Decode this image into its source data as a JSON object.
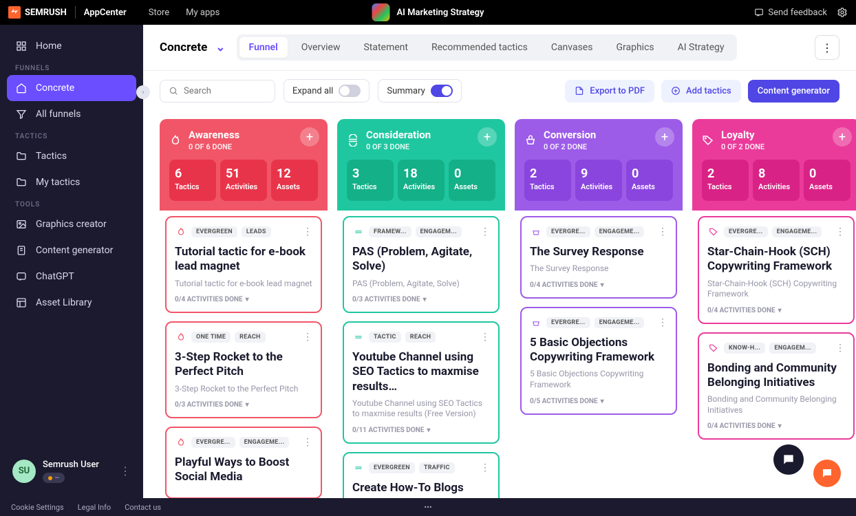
{
  "topbar": {
    "brand": "SEMRUSH",
    "appcenter": "AppCenter",
    "store": "Store",
    "myapps": "My apps",
    "title": "AI Marketing Strategy",
    "feedback": "Send feedback"
  },
  "sidebar": {
    "home": "Home",
    "funnels_label": "FUNNELS",
    "concrete": "Concrete",
    "all_funnels": "All funnels",
    "tactics_label": "TACTICS",
    "tactics": "Tactics",
    "my_tactics": "My tactics",
    "tools_label": "TOOLS",
    "graphics_creator": "Graphics creator",
    "content_generator": "Content generator",
    "chatgpt": "ChatGPT",
    "asset_library": "Asset Library",
    "user": {
      "initials": "SU",
      "name": "Semrush User",
      "plan": "--"
    }
  },
  "subheader": {
    "workspace": "Concrete",
    "tabs": {
      "funnel": "Funnel",
      "overview": "Overview",
      "statement": "Statement",
      "recommended": "Recommended tactics",
      "canvases": "Canvases",
      "graphics": "Graphics",
      "ai_strategy": "AI Strategy"
    }
  },
  "toolbar": {
    "search_placeholder": "Search",
    "expand": "Expand all",
    "summary": "Summary",
    "export": "Export to PDF",
    "add_tactics": "Add tactics",
    "content_gen": "Content generator"
  },
  "stages": {
    "awareness": {
      "title": "Awareness",
      "sub": "0 OF 6 DONE",
      "tactics_n": "6",
      "tactics_l": "Tactics",
      "act_n": "51",
      "act_l": "Activities",
      "ass_n": "12",
      "ass_l": "Assets",
      "cards": [
        {
          "tag1": "EVERGREEN",
          "tag2": "LEADS",
          "title": "Tutorial tactic for e-book lead magnet",
          "desc": "Tutorial tactic for e-book lead magnet",
          "prog": "0/4 ACTIVITIES DONE"
        },
        {
          "tag1": "ONE TIME",
          "tag2": "REACH",
          "title": "3-Step Rocket to the Perfect Pitch",
          "desc": "3-Step Rocket to the Perfect Pitch",
          "prog": "0/3 ACTIVITIES DONE"
        },
        {
          "tag1": "EVERGRE...",
          "tag2": "ENGAGEME...",
          "title": "Playful Ways to Boost Social Media",
          "desc": "",
          "prog": ""
        }
      ]
    },
    "consideration": {
      "title": "Consideration",
      "sub": "0 OF 3 DONE",
      "tactics_n": "3",
      "tactics_l": "Tactics",
      "act_n": "18",
      "act_l": "Activities",
      "ass_n": "0",
      "ass_l": "Assets",
      "cards": [
        {
          "tag1": "FRAMEW...",
          "tag2": "ENGAGEM...",
          "title": "PAS (Problem, Agitate, Solve)",
          "desc": "PAS (Problem, Agitate, Solve)",
          "prog": "0/3 ACTIVITIES DONE"
        },
        {
          "tag1": "TACTIC",
          "tag2": "REACH",
          "title": "Youtube Channel using SEO Tactics to maxmise results…",
          "desc": "Youtube Channel using SEO Tactics to maxmise results (Free Version)",
          "prog": "0/11 ACTIVITIES DONE"
        },
        {
          "tag1": "EVERGREEN",
          "tag2": "TRAFFIC",
          "title": "Create How-To Blogs",
          "desc": "",
          "prog": ""
        }
      ]
    },
    "conversion": {
      "title": "Conversion",
      "sub": "0 OF 2 DONE",
      "tactics_n": "2",
      "tactics_l": "Tactics",
      "act_n": "9",
      "act_l": "Activities",
      "ass_n": "0",
      "ass_l": "Assets",
      "cards": [
        {
          "tag1": "EVERGRE...",
          "tag2": "ENGAGEME...",
          "title": "The Survey Response",
          "desc": "The Survey Response",
          "prog": "0/4 ACTIVITIES DONE"
        },
        {
          "tag1": "EVERGRE...",
          "tag2": "ENGAGEME...",
          "title": "5 Basic Objections Copywriting Framework",
          "desc": "5 Basic Objections Copywriting Framework",
          "prog": "0/5 ACTIVITIES DONE"
        }
      ]
    },
    "loyalty": {
      "title": "Loyalty",
      "sub": "0 OF 2 DONE",
      "tactics_n": "2",
      "tactics_l": "Tactics",
      "act_n": "8",
      "act_l": "Activities",
      "ass_n": "0",
      "ass_l": "Assets",
      "cards": [
        {
          "tag1": "EVERGRE...",
          "tag2": "ENGAGEME...",
          "title": "Star-Chain-Hook (SCH) Copywriting Framework",
          "desc": "Star-Chain-Hook (SCH) Copywriting Framework",
          "prog": "0/4 ACTIVITIES DONE"
        },
        {
          "tag1": "KNOW-H...",
          "tag2": "ENGAGEM...",
          "title": "Bonding and Community Belonging Initiatives",
          "desc": "Bonding and Community Belonging Initiatives",
          "prog": "0/4 ACTIVITIES DONE"
        }
      ]
    }
  },
  "footer": {
    "cookie": "Cookie Settings",
    "legal": "Legal Info",
    "contact": "Contact us"
  }
}
